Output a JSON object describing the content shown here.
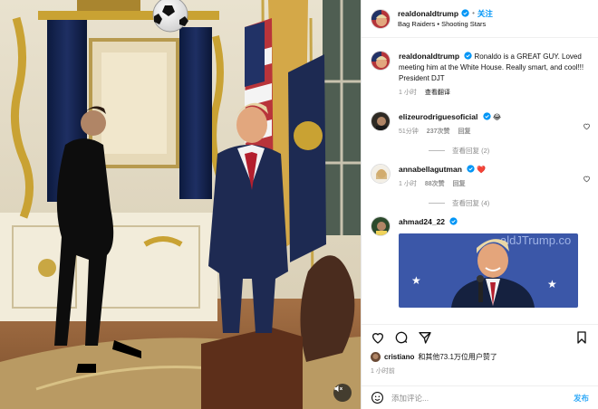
{
  "post": {
    "author": "realdonaldtrump",
    "follow_label": "关注",
    "audio": "Bag Raiders • Shooting Stars",
    "caption_author": "realdonaldtrump",
    "caption": "Ronaldo is a GREAT GUY. Loved meeting him at the White House. Really smart, and cool!!! President DJT",
    "caption_time": "1 小时",
    "caption_translate": "查看翻译"
  },
  "comments": [
    {
      "user": "elizeurodriguesoficial",
      "emoji": "😂",
      "time": "51分钟",
      "likes": "237次赞",
      "reply": "回复",
      "view_replies": "查看回复 (2)"
    },
    {
      "user": "annabellagutman",
      "emoji": "❤️",
      "time": "1 小时",
      "likes": "88次赞",
      "reply": "回复",
      "view_replies": "查看回复 (4)"
    },
    {
      "user": "ahmad24_22",
      "embed_text": "aldJTrump.co"
    }
  ],
  "likes": {
    "name": "cristiano",
    "text": "和其他73.1万位用户赞了"
  },
  "time": "1 小时前",
  "composer": {
    "placeholder": "添加评论...",
    "post_label": "发布"
  },
  "colors": {
    "accent": "#0095f6",
    "verified": "#0095f6",
    "heart": "#ed4956",
    "muted": "#8e8e8e"
  },
  "icons": [
    "heart-icon",
    "comment-icon",
    "share-icon",
    "bookmark-icon",
    "emoji-icon",
    "mute-icon",
    "verified-icon"
  ]
}
